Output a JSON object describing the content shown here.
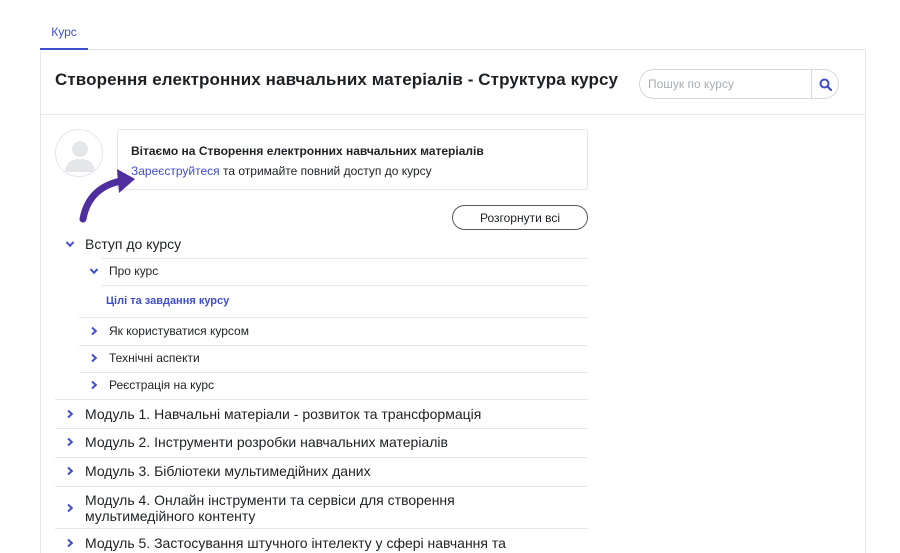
{
  "tabs": [
    {
      "label": "Курс"
    }
  ],
  "header": {
    "title": "Створення електронних навчальних матеріалів - Структура курсу",
    "search_placeholder": "Пошук по курсу"
  },
  "welcome": {
    "text": "Вітаємо на Створення електронних навчальних матеріалів",
    "register_link": "Зареєструйтеся",
    "rest": " та отримайте повний доступ до курсу"
  },
  "expand_all_label": "Розгорнути всі",
  "colors": {
    "accent": "#3e4ecf",
    "arrow": "#4f2f9e"
  },
  "sections": [
    {
      "title": "Вступ до курсу",
      "expanded": true
    },
    {
      "title": "Модуль 1. Навчальні матеріали - розвиток та трансформація",
      "expanded": false
    },
    {
      "title": "Модуль 2. Інструменти розробки навчальних матеріалів",
      "expanded": false
    },
    {
      "title": "Модуль 3. Бібліотеки мультимедійних даних",
      "expanded": false
    },
    {
      "title": "Модуль 4. Онлайн інструменти та сервіси для створення",
      "title2": "мультимедійного контенту",
      "expanded": false
    },
    {
      "title": "Модуль 5. Застосування штучного інтелекту у сфері навчання та",
      "expanded": false
    }
  ],
  "subsections": [
    {
      "title": "Про курс",
      "expanded": true,
      "activity": "Цілі та завдання курсу"
    },
    {
      "title": "Як користуватися курсом",
      "expanded": false
    },
    {
      "title": "Технічні аспекти",
      "expanded": false
    },
    {
      "title": "Реєстрація на курс",
      "expanded": false
    }
  ]
}
